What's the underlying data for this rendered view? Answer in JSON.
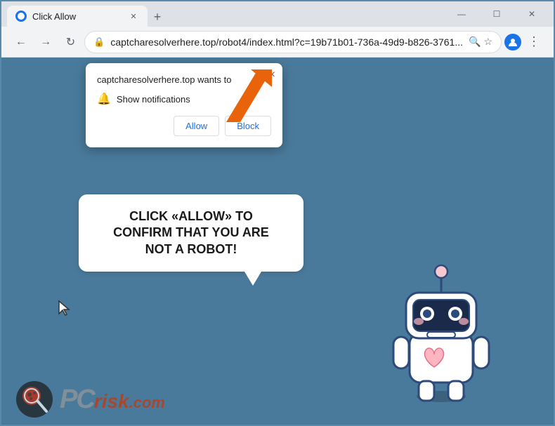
{
  "browser": {
    "tab_title": "Click Allow",
    "url": "captcharesolverhere.top/robot4/index.html?c=19b71b01-736a-49d9-b826-3761...",
    "url_full": "captcharesolverhere.top/robot4/index.html?c=19b71b01-736a-49d9-b826-3761..."
  },
  "toolbar": {
    "back_label": "←",
    "forward_label": "→",
    "reload_label": "↻",
    "new_tab_label": "+"
  },
  "window_controls": {
    "minimize": "—",
    "maximize": "☐",
    "close": "✕"
  },
  "notification_popup": {
    "title": "captcharesolverhere.top wants to",
    "notification_label": "Show notifications",
    "allow_label": "Allow",
    "block_label": "Block",
    "close_label": "×"
  },
  "speech_bubble": {
    "text": "CLICK «ALLOW» TO CONFIRM THAT YOU ARE NOT A ROBOT!"
  },
  "pcrisk": {
    "pc_label": "PC",
    "risk_label": "risk",
    "dot_com": ".com"
  },
  "icons": {
    "lock": "🔒",
    "bell": "🔔",
    "search": "🔍",
    "star": "☆",
    "profile": "👤",
    "menu": "⋮"
  }
}
